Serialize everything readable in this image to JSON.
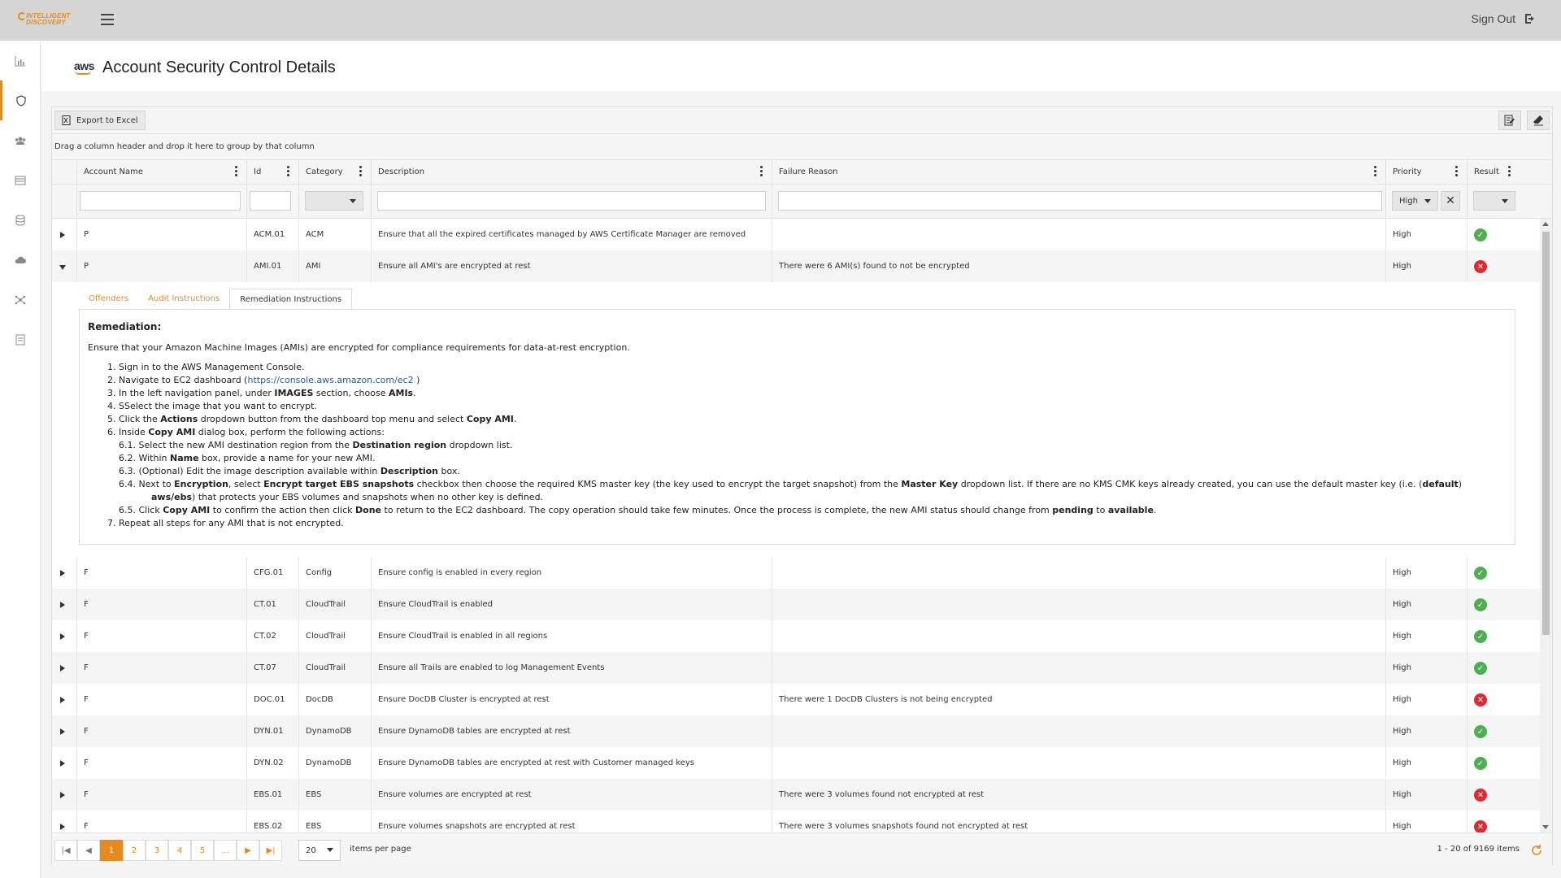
{
  "app": {
    "logo_text_line1": "INTELLIGENT",
    "logo_text_line2": "DISCOVERY",
    "sign_out_label": "Sign Out"
  },
  "page": {
    "aws_logo_text": "aws",
    "title": "Account Security Control Details"
  },
  "toolbar": {
    "export_label": "Export to Excel"
  },
  "grouping_hint": "Drag a column header and drop it here to group by that column",
  "columns": {
    "account_name": "Account Name",
    "id": "Id",
    "category": "Category",
    "description": "Description",
    "failure_reason": "Failure Reason",
    "priority": "Priority",
    "result": "Result"
  },
  "filters": {
    "priority_value": "High",
    "clear_symbol": "✕"
  },
  "rows": [
    {
      "account": "P",
      "id": "ACM.01",
      "category": "ACM",
      "description": "Ensure that all the expired certificates managed by AWS Certificate Manager are removed",
      "failure": "",
      "priority": "High",
      "result": "pass"
    },
    {
      "account": "P",
      "id": "AMI.01",
      "category": "AMI",
      "description": "Ensure all AMI's are encrypted at rest",
      "failure": "There were 6 AMI(s) found to not be encrypted",
      "priority": "High",
      "result": "fail"
    },
    {
      "account": "F",
      "id": "CFG.01",
      "category": "Config",
      "description": "Ensure config is enabled in every region",
      "failure": "",
      "priority": "High",
      "result": "pass"
    },
    {
      "account": "F",
      "id": "CT.01",
      "category": "CloudTrail",
      "description": "Ensure CloudTrail is enabled",
      "failure": "",
      "priority": "High",
      "result": "pass"
    },
    {
      "account": "F",
      "id": "CT.02",
      "category": "CloudTrail",
      "description": "Ensure CloudTrail is enabled in all regions",
      "failure": "",
      "priority": "High",
      "result": "pass"
    },
    {
      "account": "F",
      "id": "CT.07",
      "category": "CloudTrail",
      "description": "Ensure all Trails are enabled to log Management Events",
      "failure": "",
      "priority": "High",
      "result": "pass"
    },
    {
      "account": "F",
      "id": "DOC.01",
      "category": "DocDB",
      "description": "Ensure DocDB Cluster is encrypted at rest",
      "failure": "There were 1 DocDB Clusters is not being encrypted",
      "priority": "High",
      "result": "fail"
    },
    {
      "account": "F",
      "id": "DYN.01",
      "category": "DynamoDB",
      "description": "Ensure DynamoDB tables are encrypted at rest",
      "failure": "",
      "priority": "High",
      "result": "pass"
    },
    {
      "account": "F",
      "id": "DYN.02",
      "category": "DynamoDB",
      "description": "Ensure DynamoDB tables are encrypted at rest with Customer managed keys",
      "failure": "",
      "priority": "High",
      "result": "pass"
    },
    {
      "account": "F",
      "id": "EBS.01",
      "category": "EBS",
      "description": "Ensure volumes are encrypted at rest",
      "failure": "There were 3 volumes found not encrypted at rest",
      "priority": "High",
      "result": "fail"
    },
    {
      "account": "F",
      "id": "EBS.02",
      "category": "EBS",
      "description": "Ensure volumes snapshots are encrypted at rest",
      "failure": "There were 3 volumes snapshots found not encrypted at rest",
      "priority": "High",
      "result": "fail"
    }
  ],
  "detail": {
    "tabs": [
      "Offenders",
      "Audit Instructions",
      "Remediation Instructions"
    ],
    "title": "Remediation:",
    "intro": "Ensure that your Amazon Machine Images (AMIs) are encrypted for compliance requirements for data-at-rest encryption.",
    "link": "https://console.aws.amazon.com/ec2"
  },
  "pager": {
    "pages": [
      "1",
      "2",
      "3",
      "4",
      "5",
      "..."
    ],
    "page_size": "20",
    "page_size_label": "items per page",
    "info": "1 - 20 of 9169 items"
  },
  "colors": {
    "accent": "#e8891d",
    "pass": "#4caf50",
    "fail": "#e0282e"
  }
}
